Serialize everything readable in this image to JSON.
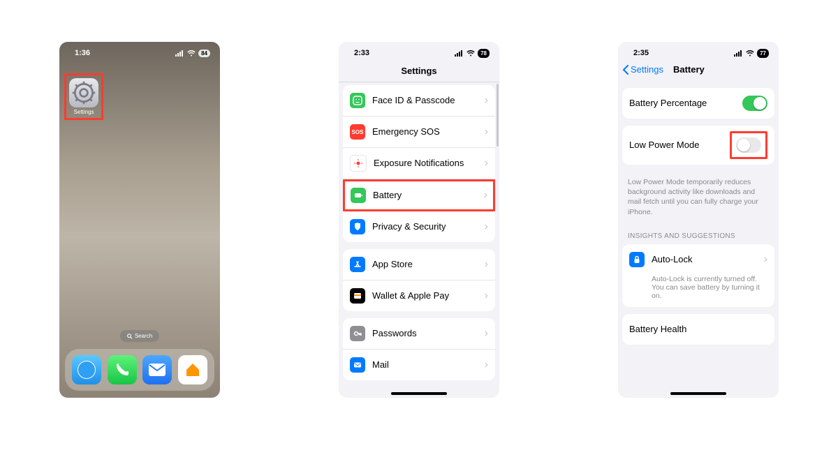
{
  "screen1": {
    "time": "1:36",
    "battery": "84",
    "settings_app_label": "Settings",
    "search_label": "Search"
  },
  "screen2": {
    "time": "2:33",
    "battery": "78",
    "nav_title": "Settings",
    "rows": {
      "faceid": "Face ID & Passcode",
      "sos_badge": "SOS",
      "sos": "Emergency SOS",
      "exposure": "Exposure Notifications",
      "battery": "Battery",
      "privacy": "Privacy & Security",
      "appstore": "App Store",
      "wallet": "Wallet & Apple Pay",
      "passwords": "Passwords",
      "mail": "Mail"
    }
  },
  "screen3": {
    "time": "2:35",
    "battery": "77",
    "back_label": "Settings",
    "nav_title": "Battery",
    "battery_percentage_label": "Battery Percentage",
    "low_power_mode_label": "Low Power Mode",
    "lpm_description": "Low Power Mode temporarily reduces background activity like downloads and mail fetch until you can fully charge your iPhone.",
    "insights_header": "INSIGHTS AND SUGGESTIONS",
    "autolock_label": "Auto-Lock",
    "autolock_desc": "Auto-Lock is currently turned off. You can save battery by turning it on.",
    "battery_health_label": "Battery Health"
  }
}
